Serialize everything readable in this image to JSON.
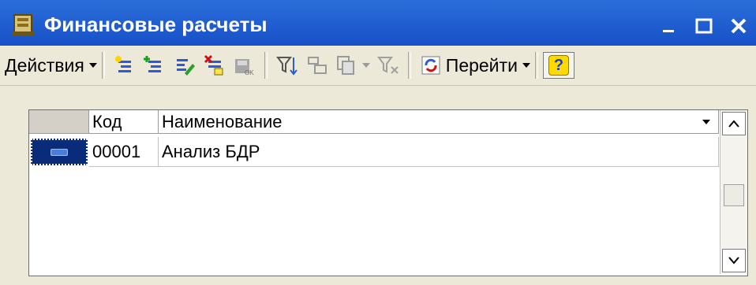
{
  "window": {
    "title": "Финансовые расчеты"
  },
  "toolbar": {
    "actions_label": "Действия",
    "goto_label": "Перейти",
    "help_label": "?"
  },
  "grid": {
    "columns": [
      "Код",
      "Наименование"
    ],
    "rows": [
      {
        "code": "00001",
        "name": "Анализ БДР"
      }
    ]
  },
  "colors": {
    "titlebar": "#1f5fd6",
    "selection": "#0a2a7a",
    "window_bg": "#ece9d8"
  }
}
